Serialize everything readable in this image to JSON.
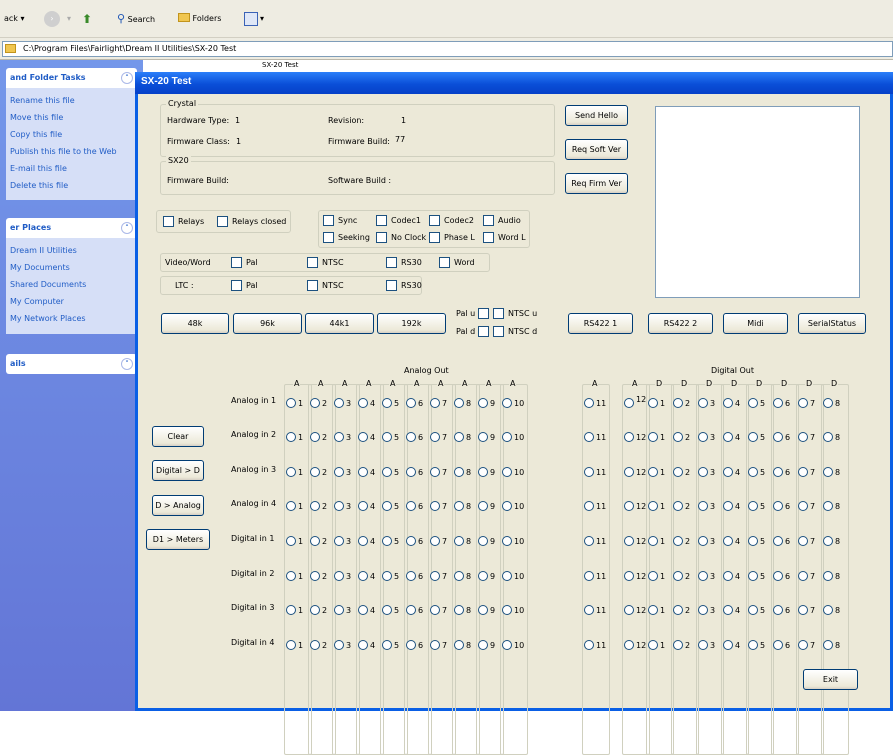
{
  "toolbar": {
    "back": "ack",
    "search": "Search",
    "folders": "Folders"
  },
  "address": "C:\\Program Files\\Fairlight\\Dream II Utilities\\SX-20 Test",
  "bg_title": "SX-20 Test",
  "side": {
    "tasks_title": "and Folder Tasks",
    "tasks": [
      "Rename this file",
      "Move this file",
      "Copy this file",
      "Publish this file to the Web",
      "E-mail this file",
      "Delete this file"
    ],
    "places_title": "er Places",
    "places": [
      "Dream II Utilities",
      "My Documents",
      "Shared Documents",
      "My Computer",
      "My Network Places"
    ],
    "details_title": "ails"
  },
  "dialog": {
    "title": "SX-20 Test",
    "crystal": {
      "label": "Crystal",
      "hw_type_label": "Hardware Type:",
      "hw_type": "1",
      "revision_label": "Revision:",
      "revision": "1",
      "fw_class_label": "Firmware Class:",
      "fw_class": "1",
      "fw_build_label": "Firmware Build:",
      "fw_build": "77"
    },
    "sx20": {
      "label": "SX20",
      "fw_build_label": "Firmware Build:",
      "sw_build_label": "Software Build :"
    },
    "buttons": {
      "send_hello": "Send Hello",
      "req_soft": "Req Soft Ver",
      "req_firm": "Req Firm Ver",
      "b48k": "48k",
      "b96k": "96k",
      "b44k1": "44k1",
      "b192k": "192k",
      "rs4221": "RS422 1",
      "rs4222": "RS422 2",
      "midi": "Midi",
      "serial": "SerialStatus",
      "clear": "Clear",
      "digital_d": "Digital > D",
      "d_analog": "D > Analog",
      "d1_meters": "D1 > Meters",
      "exit": "Exit"
    },
    "checks": {
      "relays": "Relays",
      "relays_closed": "Relays closed",
      "sync": "Sync",
      "codec1": "Codec1",
      "codec2": "Codec2",
      "audio": "Audio",
      "seeking": "Seeking",
      "no_clock": "No Clock",
      "phase_l": "Phase L",
      "word_l": "Word L",
      "video_word": "Video/Word",
      "pal": "Pal",
      "ntsc": "NTSC",
      "rs530": "RS30",
      "word": "Word",
      "ltc": "LTC :",
      "ltc_pal": "Pal",
      "ltc_ntsc": "NTSC",
      "ltc_rs530": "RS30",
      "pal_u": "Pal u",
      "ntsc_u": "NTSC u",
      "pal_d": "Pal d",
      "ntsc_d": "NTSC d"
    },
    "matrix": {
      "analog_out": "Analog Out",
      "digital_out": "Digital Out",
      "analog_col": "A",
      "digital_col": "D",
      "rows": [
        "Analog in 1",
        "Analog in 2",
        "Analog in 3",
        "Analog in 4",
        "Digital in 1",
        "Digital in 2",
        "Digital in 3",
        "Digital in 4"
      ],
      "analog_nums": [
        "1",
        "2",
        "3",
        "4",
        "5",
        "6",
        "7",
        "8",
        "9",
        "10",
        "11",
        "12"
      ],
      "digital_nums": [
        "1",
        "2",
        "3",
        "4",
        "5",
        "6",
        "7",
        "8"
      ],
      "selected_row1": "12"
    }
  }
}
